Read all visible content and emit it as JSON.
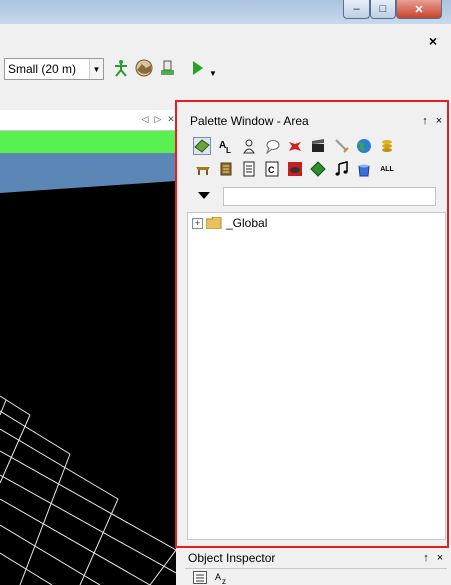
{
  "window": {
    "buttons": {
      "minimize": "–",
      "maximize": "□",
      "close": "✕"
    }
  },
  "main": {
    "close_label": "×"
  },
  "toolbar": {
    "size_value": "Small   (20 m)",
    "icons": [
      "figure-icon",
      "terrain-icon",
      "paint-icon",
      "play-icon"
    ]
  },
  "palette": {
    "title": "Palette Window - Area",
    "pin": "↑",
    "close": "×",
    "icons_row1": [
      "tile-icon",
      "text-AL-icon",
      "person-icon",
      "speech-icon",
      "creature-icon",
      "clapper-icon",
      "sword-icon",
      "globe-icon",
      "coins-icon"
    ],
    "icons_row2": [
      "table-icon",
      "scroll-icon",
      "document-icon",
      "script-icon",
      "trap-icon",
      "diamond-icon",
      "music-note-icon",
      "bucket-icon",
      "all-icon"
    ],
    "all_label": "ALL",
    "search_value": "",
    "tree": [
      {
        "label": "_Global",
        "expander": "+"
      }
    ]
  },
  "object_inspector": {
    "title": "Object Inspector",
    "pin": "↑",
    "close": "×"
  },
  "colors": {
    "highlight_border": "#e81e1e",
    "green_bar": "#58f14f",
    "sky": "#5b86b6"
  }
}
